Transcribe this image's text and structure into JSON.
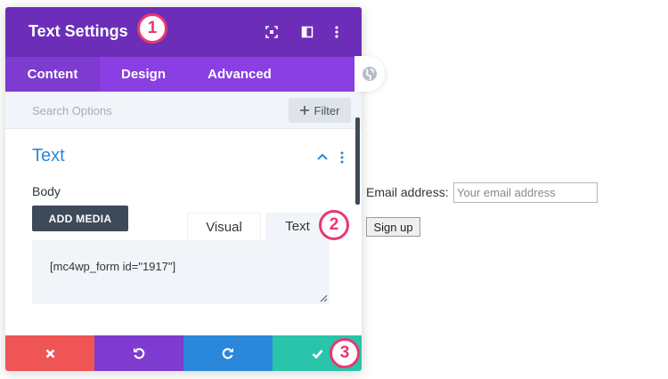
{
  "header": {
    "title": "Text Settings"
  },
  "tabs": [
    {
      "label": "Content",
      "active": true
    },
    {
      "label": "Design",
      "active": false
    },
    {
      "label": "Advanced",
      "active": false
    }
  ],
  "search": {
    "placeholder": "Search Options",
    "filter_label": "Filter"
  },
  "section": {
    "title": "Text"
  },
  "body": {
    "label": "Body",
    "add_media_label": "ADD MEDIA",
    "editor_tabs": [
      "Visual",
      "Text"
    ],
    "content": "[mc4wp_form id=\"1917\"]"
  },
  "callouts": [
    "1",
    "2",
    "3"
  ],
  "preview": {
    "email_label": "Email address:",
    "email_placeholder": "Your email address",
    "signup_label": "Sign up"
  },
  "colors": {
    "header": "#6c2eb9",
    "tabs": "#8a3fe2",
    "accent_blue": "#2b87da",
    "cancel": "#ef5555",
    "undo": "#7e3bd0",
    "redo": "#2b87da",
    "save": "#29c4a9",
    "callout": "#e8386e"
  }
}
